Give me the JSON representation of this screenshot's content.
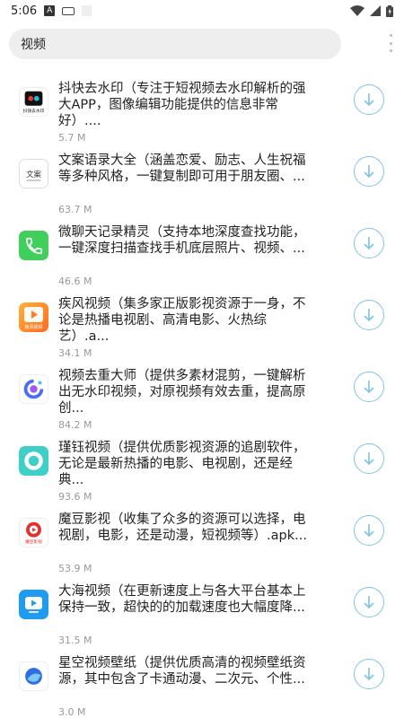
{
  "status_bar": {
    "time": "5:06",
    "notification_badge": "A"
  },
  "search": {
    "value": "视频"
  },
  "colors": {
    "accent": "#7fc4e8",
    "search_bg": "#eeeeee",
    "size_text": "#999999"
  },
  "apps": [
    {
      "title": "抖快去水印（专注于短视频去水印解析的强大APP，图像编辑功能提供的信息非常好）....",
      "size": "5.7 M",
      "icon": "watermark-remover-icon",
      "icon_text": "抖快去水印"
    },
    {
      "title": "文案语录大全（涵盖恋爱、励志、人生祝福等多种风格，一键复制即可用于朋友圈、...",
      "size": "63.7 M",
      "icon": "quotes-book-icon",
      "icon_text": "文案"
    },
    {
      "title": "微聊天记录精灵（支持本地深度查找功能，一键深度扫描查找手机底层照片、视频、...",
      "size": "46.6 M",
      "icon": "phone-icon"
    },
    {
      "title": "疾风视频（集多家正版影视资源于一身，不论是热播电视剧、高清电影、火热综艺）.a...",
      "size": "34.1 M",
      "icon": "play-icon",
      "icon_text": "疾风视频"
    },
    {
      "title": "视频去重大师（提供多素材混剪，一键解析出无水印视频，对原视频有效去重，提高原创...",
      "size": "84.2 M",
      "icon": "video-dedupe-icon"
    },
    {
      "title": "瑾钰视频（提供优质影视资源的追剧软件，无论是最新热播的电影、电视剧，还是经典...",
      "size": "93.6 M",
      "icon": "ring-icon"
    },
    {
      "title": "魔豆影视（收集了众多的资源可以选择，电视剧，电影，还是动漫，短视频等）.apk...",
      "size": "53.9 M",
      "icon": "movie-play-icon",
      "icon_text": "魔豆影视"
    },
    {
      "title": "大海视频（在更新速度上与各大平台基本上保持一致，超快的的加载速度也大幅度降...",
      "size": "31.5 M",
      "icon": "tv-play-icon"
    },
    {
      "title": "星空视频壁纸（提供优质高清的视频壁纸资源，其中包含了卡通动漫、二次元、个性...",
      "size": "3.0 M",
      "icon": "starry-wallpaper-icon"
    }
  ]
}
